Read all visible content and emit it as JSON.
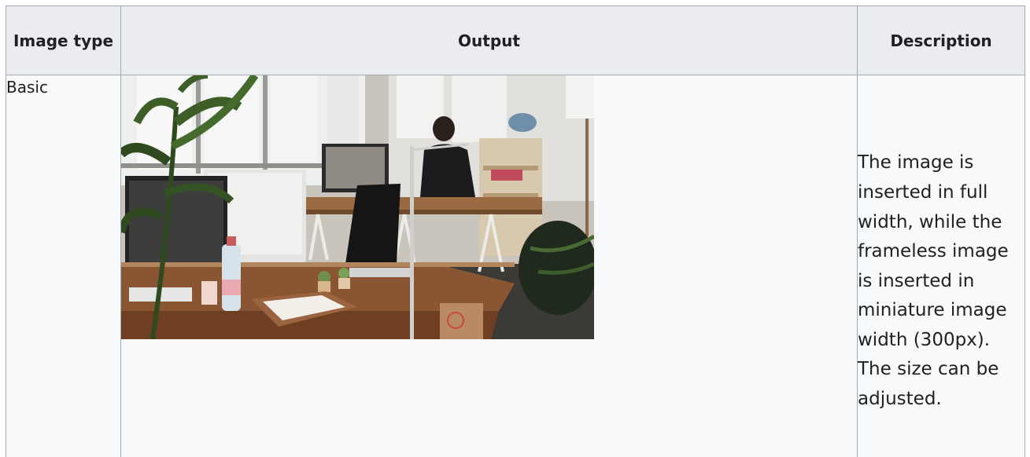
{
  "table": {
    "headers": {
      "image_type": "Image type",
      "output": "Output",
      "description": "Description"
    },
    "rows": [
      {
        "image_type": "Basic",
        "output_image": "office-photo",
        "description": "The image is inserted in full width, while the frameless image is inserted in miniature image width (300px). The size can be adjusted."
      }
    ]
  },
  "colors": {
    "header_bg": "#eaecf0",
    "cell_bg": "#f8f9fa",
    "border": "#a2a9b1",
    "text": "#202122"
  }
}
